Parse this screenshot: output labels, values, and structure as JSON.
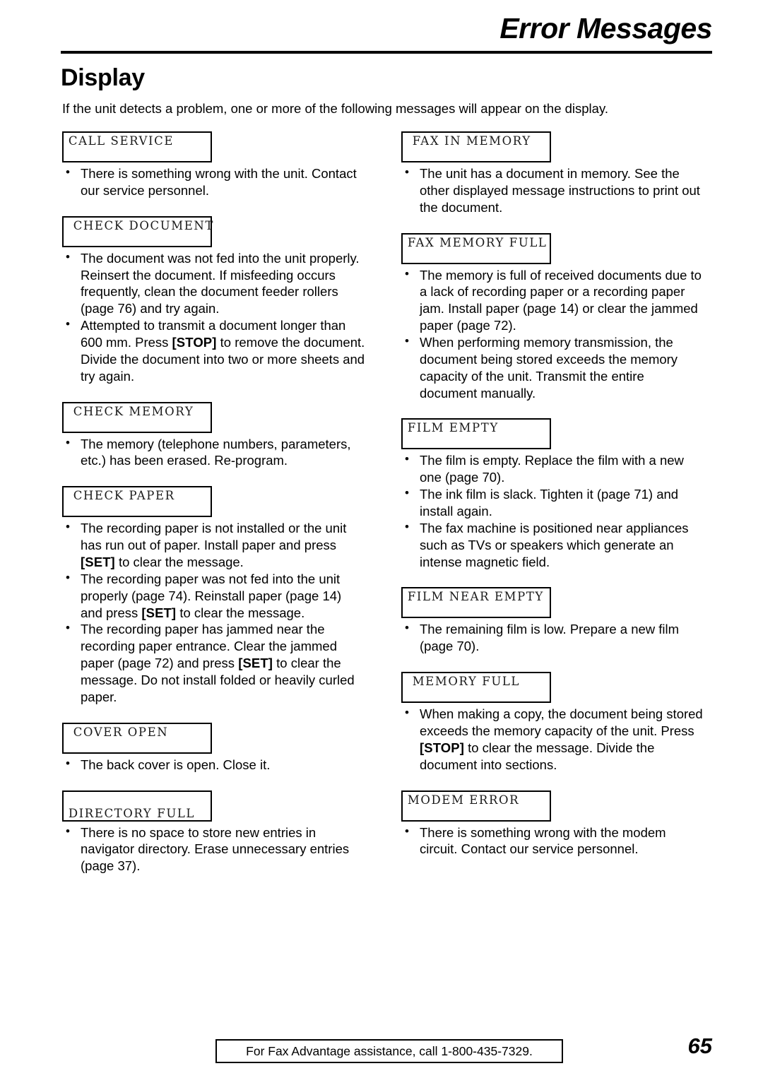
{
  "header": {
    "title": "Error Messages"
  },
  "section": {
    "heading": "Display",
    "intro": "If the unit detects a problem, one or more of the following messages will appear on the display."
  },
  "left_column": {
    "entries": [
      {
        "display_line1": " CALL SERVICE",
        "display_line2": "",
        "bullets": [
          {
            "parts": [
              {
                "text": "There is something wrong with the unit. Contact our service personnel."
              }
            ]
          }
        ]
      },
      {
        "display_line1": "  CHECK DOCUMENT",
        "display_line2": "",
        "bullets": [
          {
            "parts": [
              {
                "text": "The document was not fed into the unit properly. Reinsert the document. If misfeeding occurs frequently, clean the document feeder rollers (page 76) and try again."
              }
            ]
          },
          {
            "parts": [
              {
                "text": "Attempted to transmit a document longer than 600 mm. Press "
              },
              {
                "key": "[STOP]"
              },
              {
                "text": " to remove the document. Divide the document into two or more sheets and try again."
              }
            ]
          }
        ]
      },
      {
        "display_line1": "  CHECK MEMORY",
        "display_line2": "",
        "bullets": [
          {
            "parts": [
              {
                "text": "The memory (telephone numbers, parameters, etc.) has been erased. Re-program."
              }
            ]
          }
        ]
      },
      {
        "display_line1": "  CHECK PAPER",
        "display_line2": "",
        "bullets": [
          {
            "parts": [
              {
                "text": "The recording paper is not installed or the unit has run out of paper. Install paper and press "
              },
              {
                "key": "[SET]"
              },
              {
                "text": " to clear the message."
              }
            ]
          },
          {
            "parts": [
              {
                "text": "The recording paper was not fed into the unit properly (page 74). Reinstall paper (page 14) and press "
              },
              {
                "key": "[SET]"
              },
              {
                "text": " to clear the message."
              }
            ]
          },
          {
            "parts": [
              {
                "text": "The recording paper has jammed near the recording paper entrance. Clear the jammed paper (page 72) and press "
              },
              {
                "key": "[SET]"
              },
              {
                "text": " to clear the message. Do not install folded or heavily curled paper."
              }
            ]
          }
        ]
      },
      {
        "display_line1": "  COVER OPEN",
        "display_line2": "",
        "bullets": [
          {
            "parts": [
              {
                "text": "The back cover is open. Close it."
              }
            ]
          }
        ]
      },
      {
        "display_line1": "",
        "display_line2": " DIRECTORY FULL",
        "bullets": [
          {
            "parts": [
              {
                "text": "There is no space to store new entries in navigator directory. Erase unnecessary entries (page 37)."
              }
            ]
          }
        ]
      }
    ]
  },
  "right_column": {
    "entries": [
      {
        "display_line1": "  FAX IN MEMORY",
        "display_line2": "",
        "bullets": [
          {
            "parts": [
              {
                "text": "The unit has a document in memory. See the other displayed message instructions to print out the document."
              }
            ]
          }
        ]
      },
      {
        "display_line1": " FAX MEMORY FULL",
        "display_line2": "",
        "bullets": [
          {
            "parts": [
              {
                "text": "The memory is full of received documents due to a lack of recording paper or a recording paper jam. Install paper (page 14) or clear the jammed paper (page 72)."
              }
            ]
          },
          {
            "parts": [
              {
                "text": "When performing memory transmission, the document being stored exceeds the memory capacity of the unit. Transmit the entire document manually."
              }
            ]
          }
        ]
      },
      {
        "display_line1": " FILM EMPTY",
        "display_line2": "",
        "bullets": [
          {
            "parts": [
              {
                "text": "The film is empty. Replace the film with a new one (page 70)."
              }
            ]
          },
          {
            "parts": [
              {
                "text": "The ink film is slack. Tighten it (page 71) and install again."
              }
            ]
          },
          {
            "parts": [
              {
                "text": "The fax machine is positioned near appliances such as TVs or speakers which generate an intense magnetic field."
              }
            ]
          }
        ]
      },
      {
        "display_line1": " FILM NEAR EMPTY",
        "display_line2": "",
        "bullets": [
          {
            "parts": [
              {
                "text": "The remaining film is low. Prepare a new film (page 70)."
              }
            ]
          }
        ]
      },
      {
        "display_line1": "  MEMORY FULL",
        "display_line2": "",
        "bullets": [
          {
            "parts": [
              {
                "text": "When making a copy, the document being stored exceeds the memory capacity of the unit. Press "
              },
              {
                "key": "[STOP]"
              },
              {
                "text": " to clear the message. Divide the document into sections."
              }
            ]
          }
        ]
      },
      {
        "display_line1": " MODEM ERROR",
        "display_line2": "",
        "bullets": [
          {
            "parts": [
              {
                "text": "There is something wrong with the modem circuit. Contact our service personnel."
              }
            ]
          }
        ]
      }
    ]
  },
  "footer": {
    "assistance_text": "For Fax Advantage assistance, call 1-800-435-7329.",
    "page_number": "65"
  }
}
